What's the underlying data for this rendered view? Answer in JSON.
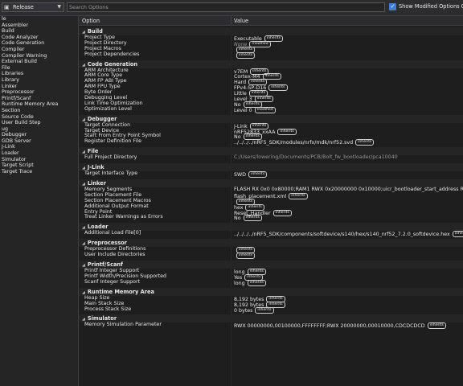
{
  "toolbar": {
    "config": "Release",
    "search_placeholder": "Search Options",
    "show_modified": "Show Modified Options Only"
  },
  "left_items": [
    "le",
    "Assembler",
    "Build",
    "Code Analyzer",
    "Code Generation",
    "Compiler",
    "Compiler Warning",
    "External Build",
    "File",
    "Libraries",
    "Library",
    "Linker",
    "Preprocessor",
    "Printf/Scanf",
    "Runtime Memory Area",
    "Section",
    "Source Code",
    "User Build Step",
    "ug",
    "Debugger",
    "GDB Server",
    "J-Link",
    "Loader",
    "Simulator",
    "Target Script",
    "Target Trace"
  ],
  "columns": {
    "option": "Option",
    "value": "Value"
  },
  "sections": [
    {
      "title": "Build",
      "rows": [
        {
          "option": "Project Type",
          "value": "Executable",
          "badge": "inherits"
        },
        {
          "option": "Project Directory",
          "value": "None",
          "badge": "modified",
          "style": "dim"
        },
        {
          "option": "Project Macros",
          "value": "",
          "badge": "inherits"
        },
        {
          "option": "Project Dependencies",
          "value": "",
          "badge": "inherits"
        }
      ]
    },
    {
      "title": "Code Generation",
      "rows": [
        {
          "option": "ARM Architecture",
          "value": "v7EM",
          "badge": "inherits"
        },
        {
          "option": "ARM Core Type",
          "value": "Cortex-M4",
          "badge": "inherits"
        },
        {
          "option": "ARM FP ABI Type",
          "value": "Hard",
          "badge": "inherits"
        },
        {
          "option": "ARM FPU Type",
          "value": "FPv4-SP-D16",
          "badge": "inherits"
        },
        {
          "option": "Byte Order",
          "value": "Little",
          "badge": "inherits"
        },
        {
          "option": "Debugging Level",
          "value": "Level 3",
          "badge": "inherits"
        },
        {
          "option": "Link Time Optimization",
          "value": "No",
          "badge": "inherits"
        },
        {
          "option": "Optimization Level",
          "value": "Level 0",
          "badge": "modified"
        }
      ]
    },
    {
      "title": "Debugger",
      "rows": [
        {
          "option": "Target Connection",
          "value": "J-Link",
          "badge": "inherits"
        },
        {
          "option": "Target Device",
          "value": "nRF52833_xxAA",
          "badge": "inherits"
        },
        {
          "option": "Start From Entry Point Symbol",
          "value": "No",
          "badge": "inherits"
        },
        {
          "option": "Register Definition File",
          "value": "../../../../nRF5_SDK/modules/nrfx/mdk/nrf52.svd",
          "badge": "inherits"
        }
      ]
    },
    {
      "title": "File",
      "rows": [
        {
          "option": "Full Project Directory",
          "value": "C:/Users/lowering/Documents/PCB/Bolt_fw_bootloader/pca10040",
          "badge": "",
          "style": "gray"
        }
      ]
    },
    {
      "title": "J-Link",
      "rows": [
        {
          "option": "Target Interface Type",
          "value": "SWD",
          "badge": "inherits"
        }
      ]
    },
    {
      "title": "Linker",
      "rows": [
        {
          "option": "Memory Segments",
          "value": "FLASH RX 0x0 0x80000;RAM1 RWX 0x20000000 0x10000;uicr_bootloader_start_address RX 0x10001014 0x4",
          "badge": ""
        },
        {
          "option": "Section Placement File",
          "value": "flash_placement.xml",
          "badge": "inherits"
        },
        {
          "option": "Section Placement Macros",
          "value": "",
          "badge": "inherits"
        },
        {
          "option": "Additional Output Format",
          "value": "hex",
          "badge": "inherits"
        },
        {
          "option": "Entry Point",
          "value": "Reset_Handler",
          "badge": "inherits"
        },
        {
          "option": "Treat Linker Warnings as Errors",
          "value": "No",
          "badge": "inherits"
        }
      ]
    },
    {
      "title": "Loader",
      "rows": [
        {
          "option": "Additional Load File[0]",
          "value": "../../../../nRF5_SDK/components/softdevice/s140/hex/s140_nrf52_7.2.0_softdevice.hex",
          "badge": "inherits"
        }
      ]
    },
    {
      "title": "Preprocessor",
      "rows": [
        {
          "option": "Preprocessor Definitions",
          "value": "",
          "badge": "inherits"
        },
        {
          "option": "User Include Directories",
          "value": "",
          "badge": "inherits"
        }
      ]
    },
    {
      "title": "Printf/Scanf",
      "rows": [
        {
          "option": "Printf Integer Support",
          "value": "long",
          "badge": "inherits"
        },
        {
          "option": "Printf Width/Precision Supported",
          "value": "Yes",
          "badge": "inherits"
        },
        {
          "option": "Scanf Integer Support",
          "value": "long",
          "badge": "inherits"
        }
      ]
    },
    {
      "title": "Runtime Memory Area",
      "rows": [
        {
          "option": "Heap Size",
          "value": "8,192 bytes",
          "badge": "inherits"
        },
        {
          "option": "Main Stack Size",
          "value": "8,192 bytes",
          "badge": "inherits"
        },
        {
          "option": "Process Stack Size",
          "value": "0 bytes",
          "badge": "inherits"
        }
      ]
    },
    {
      "title": "Simulator",
      "rows": [
        {
          "option": "Memory Simulation Parameter",
          "value": "RWX 00000000,00100000,FFFFFFFF;RWX 20000000,00010000,CDCDCDCD",
          "badge": "inherits"
        }
      ]
    }
  ]
}
